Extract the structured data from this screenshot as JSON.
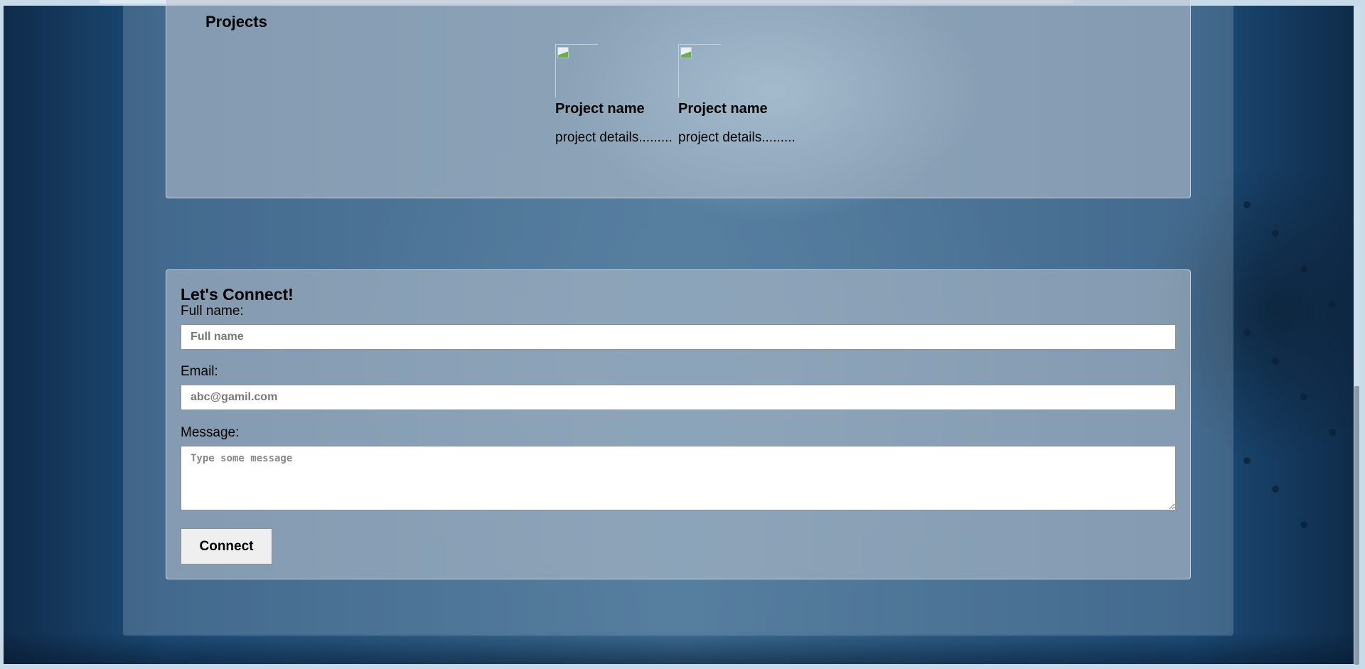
{
  "projects": {
    "title": "Projects",
    "items": [
      {
        "name": "Project name",
        "details": "project details........."
      },
      {
        "name": "Project name",
        "details": "project details........."
      }
    ]
  },
  "connect": {
    "title": "Let's Connect!",
    "fullname_label": "Full name:",
    "fullname_placeholder": "Full name",
    "email_label": "Email:",
    "email_placeholder": "abc@gamil.com",
    "message_label": "Message:",
    "message_placeholder": "Type some message",
    "button_label": "Connect"
  }
}
